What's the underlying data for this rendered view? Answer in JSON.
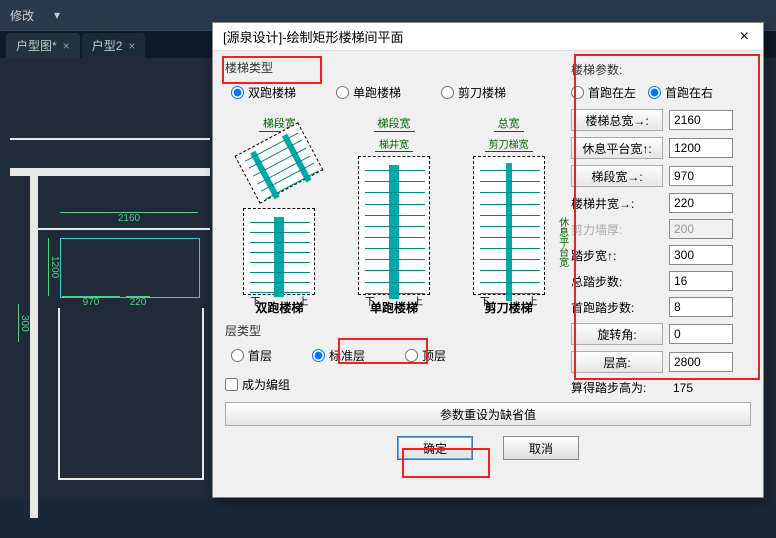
{
  "cad": {
    "menu_modify": "修改",
    "tabs": [
      {
        "label": "户型图*",
        "close": "×"
      },
      {
        "label": "户型2",
        "close": "×"
      }
    ],
    "dims": {
      "d970": "970",
      "d220": "220",
      "d2160": "2160",
      "d1200": "1200",
      "d300": "300"
    }
  },
  "dialog": {
    "title": "[源泉设计]-绘制矩形楼梯间平面",
    "close": "×",
    "stair_type": {
      "label": "楼梯类型",
      "options": {
        "double": "双跑楼梯",
        "single": "单跑楼梯",
        "scissor": "剪刀楼梯"
      },
      "selected": "double"
    },
    "diagrams": {
      "seg_width": "梯段宽",
      "well_width": "梯井宽",
      "total_width": "总宽",
      "scissor_width": "剪刀梯宽",
      "rest_width": "休息平台宽",
      "down": "下",
      "up": "上",
      "labels": {
        "double": "双跑楼梯",
        "single": "单跑楼梯",
        "scissor": "剪刀楼梯"
      }
    },
    "floor_type": {
      "label": "层类型",
      "options": {
        "first": "首层",
        "standard": "标准层",
        "top": "顶层"
      },
      "selected": "standard"
    },
    "make_group": "成为编组",
    "reset_defaults": "参数重设为缺省值",
    "ok": "确定",
    "cancel": "取消",
    "params": {
      "title": "楼梯参数:",
      "run_side": {
        "left": "首跑在左",
        "right": "首跑在右",
        "selected": "right"
      },
      "total_width": {
        "label": "楼梯总宽→:",
        "value": "2160"
      },
      "rest_width": {
        "label": "休息平台宽↑:",
        "value": "1200"
      },
      "seg_width": {
        "label": "梯段宽→:",
        "value": "970"
      },
      "well_width": {
        "label": "楼梯井宽→:",
        "value": "220"
      },
      "wall_thick": {
        "label": "剪力墙厚:",
        "value": "200"
      },
      "tread_width": {
        "label": "踏步宽↑:",
        "value": "300"
      },
      "total_steps": {
        "label": "总踏步数:",
        "value": "16"
      },
      "first_steps": {
        "label": "首跑踏步数:",
        "value": "8"
      },
      "rotation": {
        "label": "旋转角:",
        "value": "0"
      },
      "floor_height": {
        "label": "层高:",
        "value": "2800"
      },
      "riser_calc": {
        "label": "算得踏步高为:",
        "value": "175"
      }
    }
  }
}
